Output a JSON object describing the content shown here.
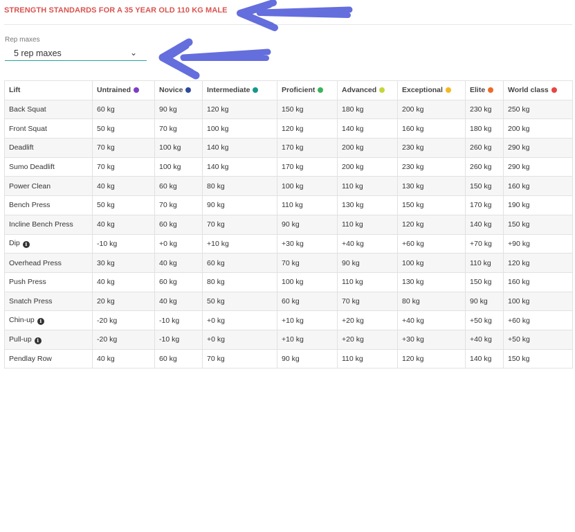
{
  "page": {
    "title": "STRENGTH STANDARDS FOR A 35 YEAR OLD 110 KG MALE"
  },
  "rep_select": {
    "label": "Rep maxes",
    "value": "5 rep maxes"
  },
  "table": {
    "headers": [
      {
        "label": "Lift",
        "dot_color": null
      },
      {
        "label": "Untrained",
        "dot_color": "#7b3fc4"
      },
      {
        "label": "Novice",
        "dot_color": "#2e4a9e"
      },
      {
        "label": "Intermediate",
        "dot_color": "#16998a"
      },
      {
        "label": "Proficient",
        "dot_color": "#3cb35c"
      },
      {
        "label": "Advanced",
        "dot_color": "#c4d63a"
      },
      {
        "label": "Exceptional",
        "dot_color": "#f5b821"
      },
      {
        "label": "Elite",
        "dot_color": "#ef6a2a"
      },
      {
        "label": "World class",
        "dot_color": "#e84545"
      }
    ],
    "rows": [
      {
        "lift": "Back Squat",
        "info": false,
        "values": [
          "60 kg",
          "90 kg",
          "120 kg",
          "150 kg",
          "180 kg",
          "200 kg",
          "230 kg",
          "250 kg"
        ]
      },
      {
        "lift": "Front Squat",
        "info": false,
        "values": [
          "50 kg",
          "70 kg",
          "100 kg",
          "120 kg",
          "140 kg",
          "160 kg",
          "180 kg",
          "200 kg"
        ]
      },
      {
        "lift": "Deadlift",
        "info": false,
        "values": [
          "70 kg",
          "100 kg",
          "140 kg",
          "170 kg",
          "200 kg",
          "230 kg",
          "260 kg",
          "290 kg"
        ]
      },
      {
        "lift": "Sumo Deadlift",
        "info": false,
        "values": [
          "70 kg",
          "100 kg",
          "140 kg",
          "170 kg",
          "200 kg",
          "230 kg",
          "260 kg",
          "290 kg"
        ]
      },
      {
        "lift": "Power Clean",
        "info": false,
        "values": [
          "40 kg",
          "60 kg",
          "80 kg",
          "100 kg",
          "110 kg",
          "130 kg",
          "150 kg",
          "160 kg"
        ]
      },
      {
        "lift": "Bench Press",
        "info": false,
        "values": [
          "50 kg",
          "70 kg",
          "90 kg",
          "110 kg",
          "130 kg",
          "150 kg",
          "170 kg",
          "190 kg"
        ]
      },
      {
        "lift": "Incline Bench Press",
        "info": false,
        "values": [
          "40 kg",
          "60 kg",
          "70 kg",
          "90 kg",
          "110 kg",
          "120 kg",
          "140 kg",
          "150 kg"
        ]
      },
      {
        "lift": "Dip",
        "info": true,
        "values": [
          "-10 kg",
          "+0 kg",
          "+10 kg",
          "+30 kg",
          "+40 kg",
          "+60 kg",
          "+70 kg",
          "+90 kg"
        ]
      },
      {
        "lift": "Overhead Press",
        "info": false,
        "values": [
          "30 kg",
          "40 kg",
          "60 kg",
          "70 kg",
          "90 kg",
          "100 kg",
          "110 kg",
          "120 kg"
        ]
      },
      {
        "lift": "Push Press",
        "info": false,
        "values": [
          "40 kg",
          "60 kg",
          "80 kg",
          "100 kg",
          "110 kg",
          "130 kg",
          "150 kg",
          "160 kg"
        ]
      },
      {
        "lift": "Snatch Press",
        "info": false,
        "values": [
          "20 kg",
          "40 kg",
          "50 kg",
          "60 kg",
          "70 kg",
          "80 kg",
          "90 kg",
          "100 kg"
        ]
      },
      {
        "lift": "Chin-up",
        "info": true,
        "values": [
          "-20 kg",
          "-10 kg",
          "+0 kg",
          "+10 kg",
          "+20 kg",
          "+40 kg",
          "+50 kg",
          "+60 kg"
        ]
      },
      {
        "lift": "Pull-up",
        "info": true,
        "values": [
          "-20 kg",
          "-10 kg",
          "+0 kg",
          "+10 kg",
          "+20 kg",
          "+30 kg",
          "+40 kg",
          "+50 kg"
        ]
      },
      {
        "lift": "Pendlay Row",
        "info": false,
        "values": [
          "40 kg",
          "60 kg",
          "70 kg",
          "90 kg",
          "110 kg",
          "120 kg",
          "140 kg",
          "150 kg"
        ]
      }
    ]
  },
  "annotations": {
    "arrow_color": "#4a55d8"
  }
}
